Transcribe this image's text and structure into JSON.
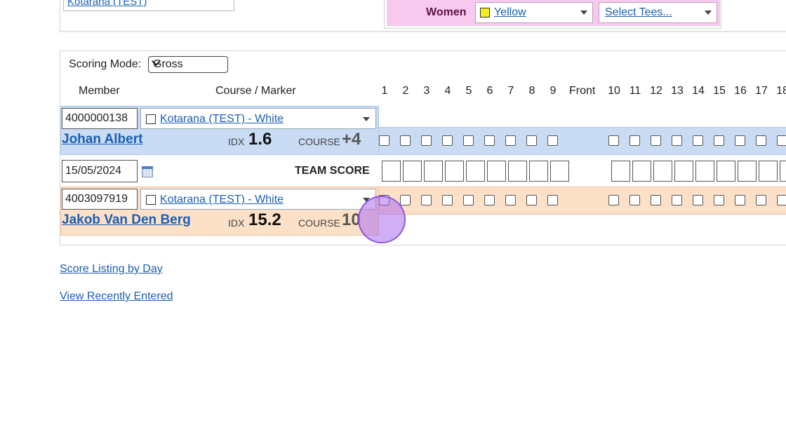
{
  "top": {
    "club_select": "Kotarana (TEST)",
    "women_label": "Women",
    "women_tee": "Yellow",
    "select_tees": "Select Tees..."
  },
  "scoring": {
    "mode_label": "Scoring Mode:",
    "mode_value": "Gross"
  },
  "columns": {
    "member": "Member",
    "course_marker": "Course / Marker",
    "front": "Front",
    "holes_front": [
      "1",
      "2",
      "3",
      "4",
      "5",
      "6",
      "7",
      "8",
      "9"
    ],
    "holes_back": [
      "10",
      "11",
      "12",
      "13",
      "14",
      "15",
      "16",
      "17",
      "18"
    ]
  },
  "players": [
    {
      "member_no": "4000000138",
      "course": "Kotarana (TEST) - White",
      "name": "Johan Albert",
      "idx_label": "IDX",
      "idx": "1.6",
      "course_label": "COURSE",
      "course_hcp": "+4"
    },
    {
      "member_no": "4003097919",
      "course": "Kotarana (TEST) - White",
      "name": "Jakob Van Den Berg",
      "idx_label": "IDX",
      "idx": "15.2",
      "course_label": "COURSE",
      "course_hcp": "10"
    }
  ],
  "team": {
    "date": "15/05/2024",
    "label": "TEAM SCORE"
  },
  "links": {
    "score_listing": "Score Listing by Day",
    "recently_entered": "View Recently Entered"
  },
  "colors": {
    "row_blue": "#c9dcf4",
    "row_orange": "#fde0c8",
    "tees_pink": "#f7c9ef",
    "link": "#1a5fb4"
  }
}
